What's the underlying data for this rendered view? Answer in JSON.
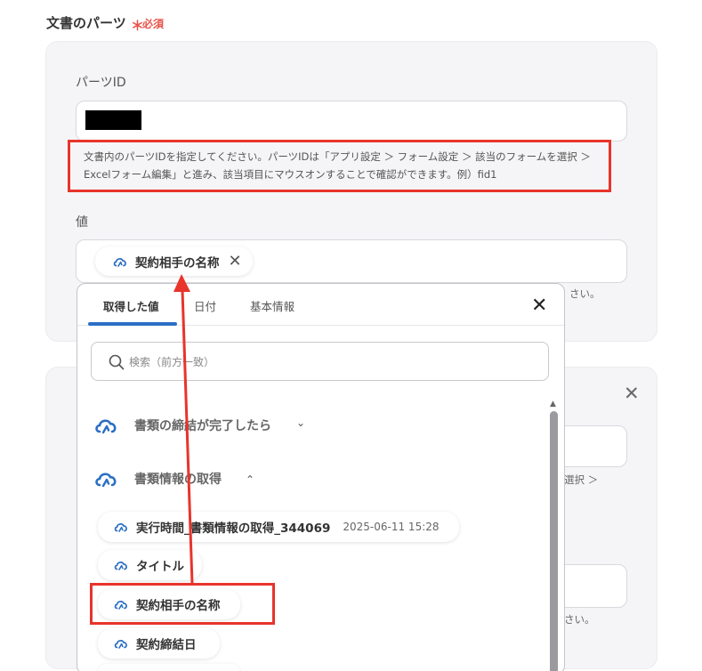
{
  "section": {
    "title": "文書のパーツ",
    "required_star": "＊",
    "required_text": "必須"
  },
  "card1": {
    "parts_id_label": "パーツID",
    "help_line1": "文書内のパーツIDを指定してください。パーツIDは「アプリ設定 ＞ フォーム設定 ＞ 該当のフォームを選択 ＞",
    "help_line2": "Excelフォーム編集」と進み、該当項目にマウスオンすることで確認ができます。例）fid1",
    "value_label": "値",
    "value_chip": "契約相手の名称",
    "value_chip_x": "✕",
    "peek_text": "さい。"
  },
  "card2": {
    "close": "✕",
    "peek_select": "選択 ＞",
    "peek_text": "さい。"
  },
  "dropdown": {
    "tabs": [
      "取得した値",
      "日付",
      "基本情報"
    ],
    "close": "✕",
    "search_placeholder": "検索（前方一致）",
    "groups": [
      {
        "label": "書類の締結が完了したら",
        "chevron": "⌄"
      },
      {
        "label": "書類情報の取得",
        "chevron": "⌃"
      }
    ],
    "items": [
      {
        "label": "実行時間_書類情報の取得_344069",
        "timestamp": "2025-06-11 15:28"
      },
      {
        "label": "タイトル"
      },
      {
        "label": "契約相手の名称"
      },
      {
        "label": "契約締結日"
      }
    ]
  },
  "colors": {
    "accent_blue": "#2b6fc4",
    "annotation_red": "#e8342b",
    "required_red": "#e8534a"
  }
}
